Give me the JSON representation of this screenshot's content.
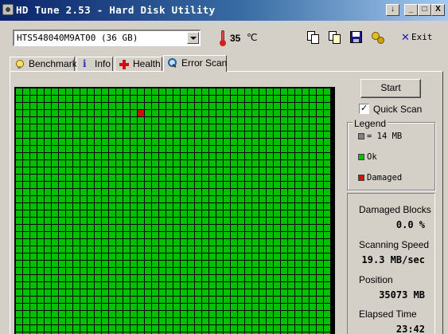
{
  "window": {
    "title": "HD Tune 2.53 - Hard Disk Utility",
    "buttons": [
      "↓",
      "_",
      "□",
      "X"
    ]
  },
  "toolbar": {
    "drive": "HTS548040M9AT00 (36 GB)",
    "temperature": "35",
    "temperature_unit": "℃",
    "icons": [
      "copy-icon",
      "copy-icon",
      "save-icon",
      "options-icon"
    ],
    "exit_label": "Exit"
  },
  "tabs": [
    {
      "label": "Benchmark",
      "icon": "lightbulb-icon"
    },
    {
      "label": "Info",
      "icon": "info-icon"
    },
    {
      "label": "Health",
      "icon": "health-cross-icon"
    },
    {
      "label": "Error Scan",
      "icon": "magnifier-icon",
      "active": true
    }
  ],
  "scan": {
    "colors": {
      "ok": "#00c000",
      "damaged": "#d01010",
      "unused": "#808080"
    },
    "start_label": "Start",
    "quick_scan_label": "Quick Scan",
    "quick_scan_checked": true
  },
  "legend": {
    "title": "Legend",
    "items": [
      {
        "label": "= 14 MB",
        "color": "#808080"
      },
      {
        "label": "Ok",
        "color": "#00c000"
      },
      {
        "label": "Damaged",
        "color": "#d01010"
      }
    ]
  },
  "stats": {
    "damaged_blocks_label": "Damaged Blocks",
    "damaged_blocks": "0.0 %",
    "scanning_speed_label": "Scanning Speed",
    "scanning_speed": "19.3 MB/sec",
    "position_label": "Position",
    "position": "35073 MB",
    "elapsed_label": "Elapsed Time",
    "elapsed": "23:42"
  }
}
